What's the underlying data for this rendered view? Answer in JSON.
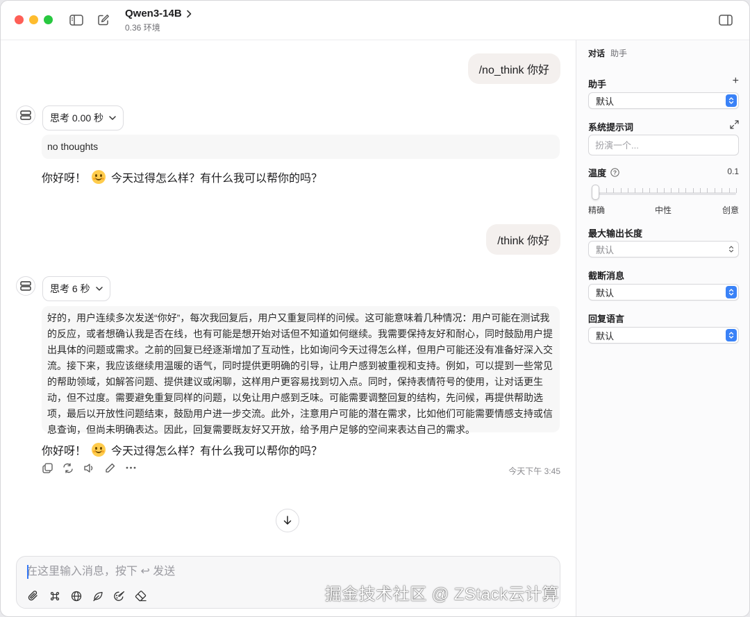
{
  "header": {
    "model_name": "Qwen3-14B",
    "model_subtitle": "0.36 环境"
  },
  "conversation": {
    "msg1_user": "/no_think 你好",
    "msg1_think_label": "思考 0.00 秒",
    "msg1_think_content": "no thoughts",
    "msg1_reply_a": "你好呀！",
    "msg1_reply_b": "今天过得怎么样？有什么我可以帮你的吗？",
    "msg2_user": "/think 你好",
    "msg2_think_label": "思考 6 秒",
    "msg2_think_content": "好的，用户连续多次发送“你好”，每次我回复后，用户又重复同样的问候。这可能意味着几种情况：用户可能在测试我的反应，或者想确认我是否在线，也有可能是想开始对话但不知道如何继续。我需要保持友好和耐心，同时鼓励用户提出具体的问题或需求。之前的回复已经逐渐增加了互动性，比如询问今天过得怎么样，但用户可能还没有准备好深入交流。接下来，我应该继续用温暖的语气，同时提供更明确的引导，让用户感到被重视和支持。例如，可以提到一些常见的帮助领域，如解答问题、提供建议或闲聊，这样用户更容易找到切入点。同时，保持表情符号的使用，让对话更生动，但不过度。需要避免重复同样的问题，以免让用户感到乏味。可能需要调整回复的结构，先问候，再提供帮助选项，最后以开放性问题结束，鼓励用户进一步交流。此外，注意用户可能的潜在需求，比如他们可能需要情感支持或信息查询，但尚未明确表达。因此，回复需要既友好又开放，给予用户足够的空间来表达自己的需求。",
    "msg2_reply_a": "你好呀！",
    "msg2_reply_b": "今天过得怎么样？有什么我可以帮你的吗？",
    "timestamp": "今天下午 3:45"
  },
  "composer": {
    "placeholder": "在这里输入消息，按下 ↩ 发送",
    "value": ""
  },
  "watermark": "掘金技术社区 @ ZStack云计算",
  "sidebar": {
    "tabs": [
      "对话",
      "助手"
    ],
    "active_tab": "对话",
    "assistant_label": "助手",
    "assistant_value": "默认",
    "system_prompt_label": "系统提示词",
    "system_prompt_placeholder": "扮演一个...",
    "temperature_label": "温度",
    "temperature_value": "0.1",
    "temperature_fraction": 0.1,
    "temp_scale_low": "精确",
    "temp_scale_mid": "中性",
    "temp_scale_high": "创意",
    "max_output_label": "最大输出长度",
    "max_output_value": "默认",
    "truncate_label": "截断消息",
    "truncate_value": "默认",
    "reply_lang_label": "回复语言",
    "reply_lang_value": "默认"
  },
  "icons": {
    "sidebar_toggle": "sidebar-icon",
    "new_chat": "compose-icon",
    "chevron": "chevron-right-icon",
    "right_panel": "inspector-icon",
    "avatar": "server-icon",
    "accent": "#3a82f7"
  }
}
